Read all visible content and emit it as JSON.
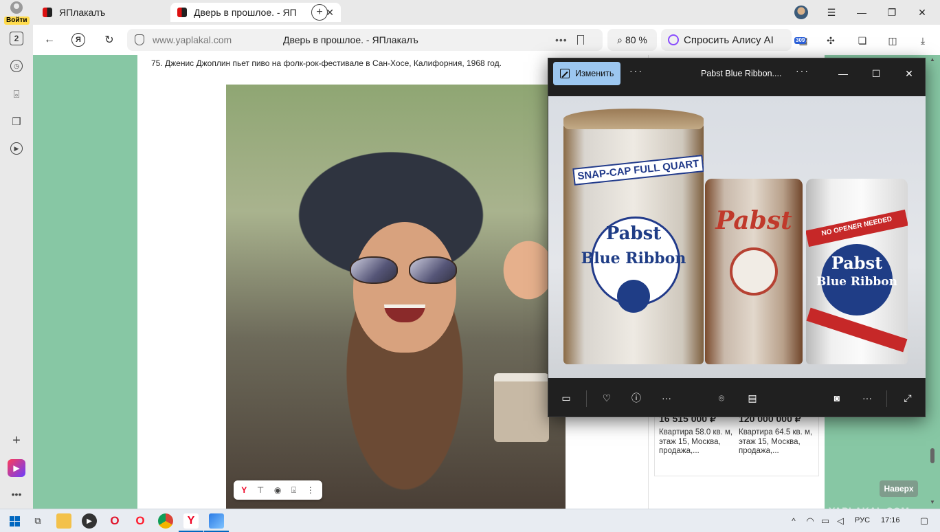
{
  "browser": {
    "login_label": "Войти",
    "tab_counter": "2",
    "tabs": [
      {
        "label": "ЯПлакалъ",
        "active": false
      },
      {
        "label": "Дверь в прошлое. - ЯП",
        "active": true
      }
    ],
    "url": "www.yaplakal.com",
    "page_title": "Дверь в прошлое. - ЯПлакалъ",
    "zoom": "80 %",
    "alice_label": "Спросить Алису AI",
    "extension_count": "309"
  },
  "page": {
    "caption": "75. Дженис Джоплин пьет пиво на фолк-рок-фестивале в Сан-Хосе, Калифорния, 1968 год.",
    "ads": [
      {
        "price": "16 515 000 ₽",
        "desc": "Квартира 58.0 кв. м, этаж 15, Москва, продажа,..."
      },
      {
        "price": "120 000 000 ₽",
        "desc": "Квартира 64.5 кв. м, этаж 15, Москва, продажа,..."
      }
    ],
    "scroll_top_label": "Наверх",
    "watermark": "YAPLAKAL.COM"
  },
  "viewer": {
    "edit_label": "Изменить",
    "file_title": "Pabst Blue Ribbon....",
    "can_texts": {
      "snapcap": "SNAP-CAP FULL QUART",
      "brand_big": "Pabst",
      "brand_big2": "Blue Ribbon",
      "brand_mid": "Pabst",
      "brand_small": "Pabst",
      "brand_small2": "Blue Ribbon",
      "no_opener": "NO OPENER NEEDED"
    }
  },
  "taskbar": {
    "lang": "РУС",
    "time": "17:16"
  },
  "colors": {
    "page_bg": "#87c7a4",
    "viewer_bg": "#202020",
    "edit_button": "#9cc7f0",
    "accent_blue": "#0067c0"
  }
}
